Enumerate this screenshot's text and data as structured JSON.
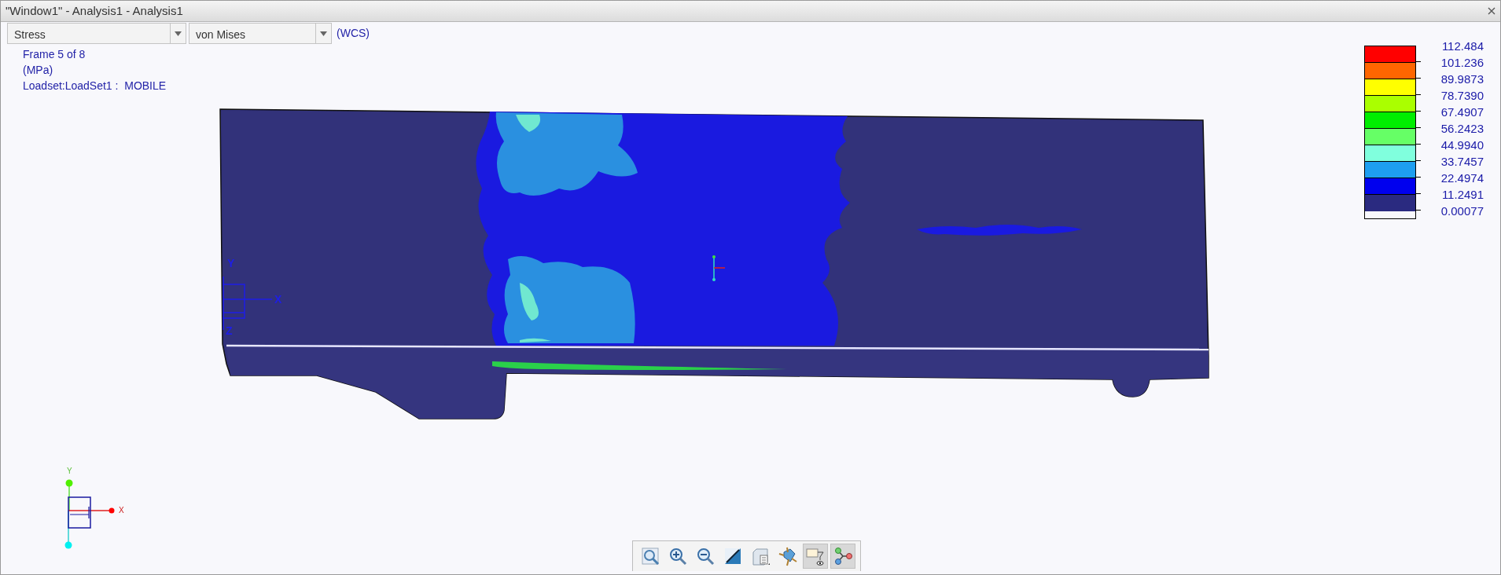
{
  "window": {
    "title": "\"Window1\" - Analysis1 - Analysis1"
  },
  "selectors": [
    {
      "value": "Stress"
    },
    {
      "value": "von Mises"
    }
  ],
  "coordinate_system": "(WCS)",
  "info_lines": [
    "Frame 5 of 8",
    "(MPa)",
    "Loadset:LoadSet1 :  MOBILE"
  ],
  "legend": {
    "bands": [
      {
        "color": "#ff0000"
      },
      {
        "color": "#ff6600"
      },
      {
        "color": "#ffff00"
      },
      {
        "color": "#aaff00"
      },
      {
        "color": "#00ee00"
      },
      {
        "color": "#66ff66"
      },
      {
        "color": "#80ffdd"
      },
      {
        "color": "#1e9ef0"
      },
      {
        "color": "#0000ee"
      },
      {
        "color": "#2a2a80"
      }
    ],
    "labels": [
      "112.484",
      "101.236",
      "89.9873",
      "78.7390",
      "67.4907",
      "56.2423",
      "44.9940",
      "33.7457",
      "22.4974",
      "11.2491",
      "0.00077"
    ]
  },
  "model_csys": {
    "axes": [
      "Y",
      "X",
      "Z"
    ]
  },
  "view_triad": {
    "axes": [
      "Y",
      "X"
    ]
  },
  "toolbar": [
    {
      "kind": "refit",
      "selected": false
    },
    {
      "kind": "zoom-in",
      "selected": false
    },
    {
      "kind": "zoom-out",
      "selected": false
    },
    {
      "kind": "repaint",
      "selected": false
    },
    {
      "kind": "saved-views",
      "selected": false
    },
    {
      "kind": "spin-center",
      "selected": false
    },
    {
      "kind": "display-style",
      "selected": true
    },
    {
      "kind": "datum-display",
      "selected": true
    }
  ]
}
